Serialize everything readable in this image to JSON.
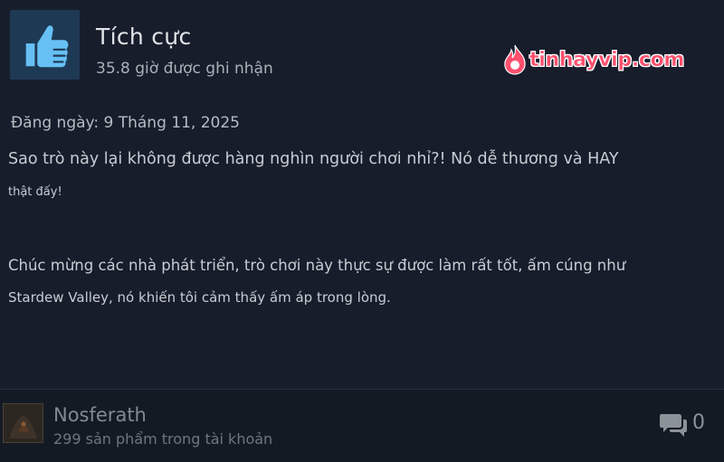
{
  "review": {
    "verdict": "Tích cực",
    "hours": "35.8 giờ được ghi nhận",
    "posted": "Đăng ngày: 9 Tháng 11, 2025",
    "lines": [
      "Sao trò này lại không được hàng nghìn người chơi nhỉ?! Nó dễ thương và HAY",
      "thật đấy!",
      "Chúc mừng các nhà phát triển, trò chơi này thực sự được làm rất tốt, ấm cúng như",
      "Stardew Valley, nó khiến tôi cảm thấy ấm áp trong lòng."
    ]
  },
  "watermark": {
    "text": "tinhayvip.com",
    "color": "#ff4f6d"
  },
  "author": {
    "name": "Nosferath",
    "products": "299 sản phẩm trong tài khoản"
  },
  "comments": {
    "count": "0"
  },
  "icons": {
    "thumb": "thumbs-up-icon",
    "comment": "comment-bubbles-icon",
    "flame": "flame-logo-icon"
  },
  "colors": {
    "background": "#171d2b",
    "thumb_box": "#1e3954",
    "thumb_icon": "#66c0f4",
    "watermark": "#ff4f6d"
  }
}
